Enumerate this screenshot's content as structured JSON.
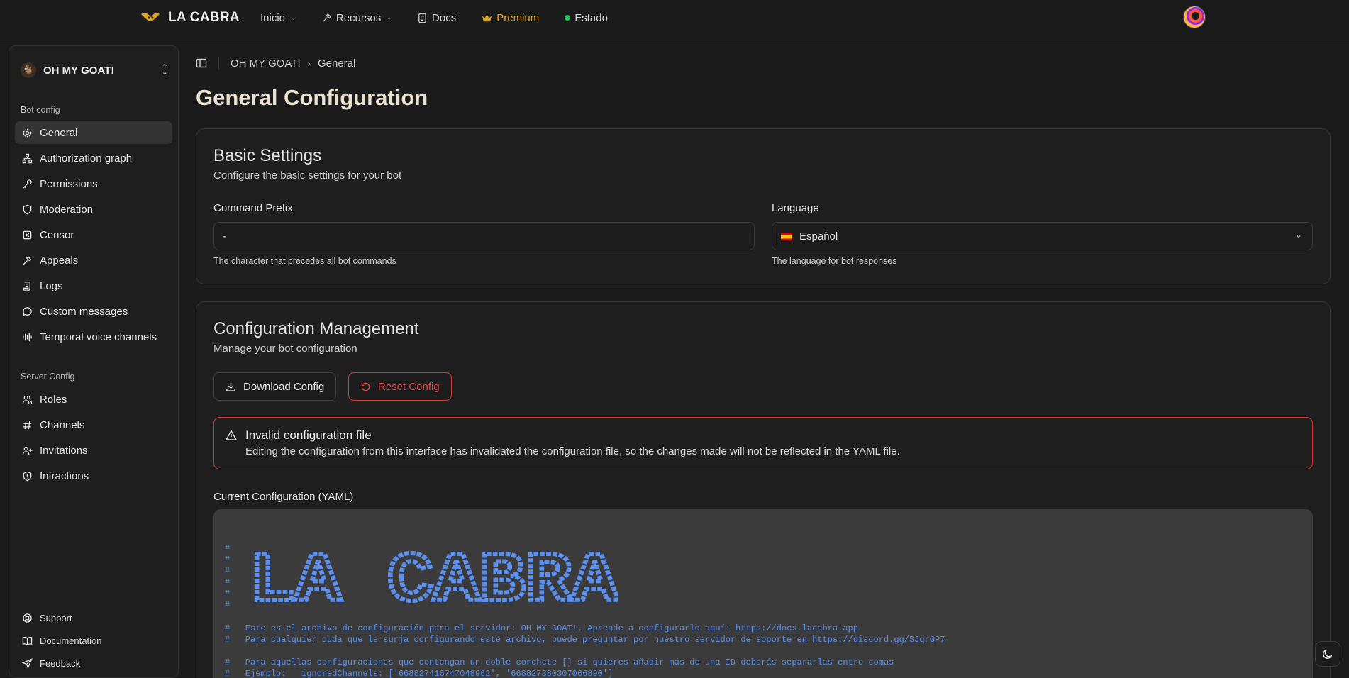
{
  "brand": {
    "name": "LA CABRA"
  },
  "nav": {
    "items": [
      {
        "label": "Inicio",
        "dropdown": true
      },
      {
        "label": "Recursos",
        "dropdown": true
      },
      {
        "label": "Docs"
      },
      {
        "label": "Premium",
        "color": "#e3a528"
      },
      {
        "label": "Estado",
        "status_color": "#22c55e"
      }
    ]
  },
  "sidebar": {
    "server_name": "OH MY GOAT!",
    "bot_config_label": "Bot config",
    "bot_config_items": [
      {
        "label": "General",
        "icon": "gear-icon",
        "active": true
      },
      {
        "label": "Authorization graph",
        "icon": "network-icon"
      },
      {
        "label": "Permissions",
        "icon": "key-icon"
      },
      {
        "label": "Moderation",
        "icon": "shield-icon"
      },
      {
        "label": "Censor",
        "icon": "censor-icon"
      },
      {
        "label": "Appeals",
        "icon": "gavel-icon"
      },
      {
        "label": "Logs",
        "icon": "scroll-icon"
      },
      {
        "label": "Custom messages",
        "icon": "message-icon"
      },
      {
        "label": "Temporal voice channels",
        "icon": "audio-wave-icon"
      }
    ],
    "server_config_label": "Server Config",
    "server_config_items": [
      {
        "label": "Roles",
        "icon": "users-icon"
      },
      {
        "label": "Channels",
        "icon": "hash-icon"
      },
      {
        "label": "Invitations",
        "icon": "user-plus-icon"
      },
      {
        "label": "Infractions",
        "icon": "shield-alert-icon"
      }
    ],
    "footer_items": [
      {
        "label": "Support",
        "icon": "lifebuoy-icon"
      },
      {
        "label": "Documentation",
        "icon": "book-icon"
      },
      {
        "label": "Feedback",
        "icon": "send-icon"
      }
    ]
  },
  "breadcrumb": {
    "server": "OH MY GOAT!",
    "page": "General"
  },
  "page": {
    "title": "General Configuration"
  },
  "basic": {
    "title": "Basic Settings",
    "subtitle": "Configure the basic settings for your bot",
    "prefix_label": "Command Prefix",
    "prefix_value": "-",
    "prefix_hint": "The character that precedes all bot commands",
    "language_label": "Language",
    "language_value": "Español",
    "language_hint": "The language for bot responses"
  },
  "config": {
    "title": "Configuration Management",
    "subtitle": "Manage your bot configuration",
    "download_label": "Download Config",
    "reset_label": "Reset Config",
    "alert_title": "Invalid configuration file",
    "alert_text": "Editing the configuration from this interface has invalidated the configuration file, so the changes made will not be reflected in the YAML file.",
    "yaml_label": "Current Configuration (YAML)",
    "yaml_comment_marks": [
      "#",
      "#",
      "#",
      "#",
      "#",
      "#"
    ],
    "yaml_lines": [
      "#   Este es el archivo de configuración para el servidor: OH MY GOAT!. Aprende a configurarlo aquí: https://docs.lacabra.app",
      "#   Para cualquier duda que le surja configurando este archivo, puede preguntar por nuestro servidor de soporte en https://discord.gg/SJqrGP7",
      "#   Para aquellas configuraciones que contengan un doble corchete [] si quieres añadir más de una ID deberás separarlas entre comas",
      "#   Ejemplo:   ignoredChannels: ['668827416747048962', '668827380307066890']"
    ],
    "ascii_art_text": "LA CABRA",
    "accent_color": "#5b8ff0"
  }
}
